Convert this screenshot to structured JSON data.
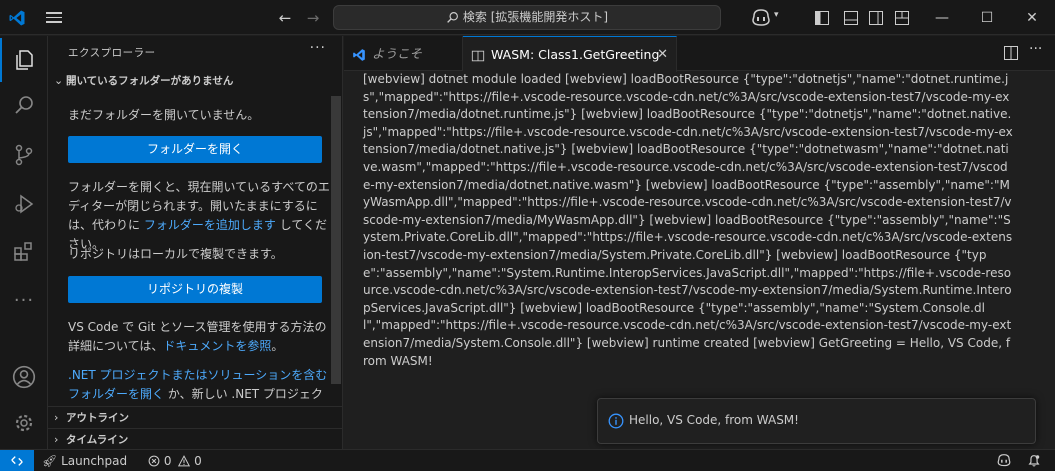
{
  "titlebar": {
    "search_text": "検索 [拡張機能開発ホスト]"
  },
  "sidebar": {
    "title": "エクスプローラー",
    "more": "···",
    "no_folder_section": "開いているフォルダーがありません",
    "no_folder_text": "まだフォルダーを開いていません。",
    "open_folder_button": "フォルダーを開く",
    "info_text_1": "フォルダーを開くと、現在開いているすべてのエディターが閉じられます。開いたままにするには、代わりに",
    "add_folder_link": "フォルダーを追加します",
    "info_text_2": "してください。",
    "clone_text": "リポジトリはローカルで複製できます。",
    "clone_button": "リポジトリの複製",
    "git_text": "VS Code で Git とソース管理を使用する方法の詳細については、",
    "docs_link": "ドキュメントを参照",
    "git_text_end": "。",
    "dotnet_link": ".NET プロジェクトまたはソリューションを含むフォルダーを開く",
    "dotnet_text": "か、新しい .NET プロジェクトを作成できま",
    "outline_section": "アウトライン",
    "timeline_section": "タイムライン"
  },
  "tabs": [
    {
      "label": "ようこそ"
    },
    {
      "label": "WASM: Class1.GetGreeting",
      "close": "✕"
    }
  ],
  "editor": {
    "log_text": "[webview] dotnet module loaded [webview] loadBootResource {\"type\":\"dotnetjs\",\"name\":\"dotnet.runtime.js\",\"mapped\":\"https://file+.vscode-resource.vscode-cdn.net/c%3A/src/vscode-extension-test7/vscode-my-extension7/media/dotnet.runtime.js\"} [webview] loadBootResource {\"type\":\"dotnetjs\",\"name\":\"dotnet.native.js\",\"mapped\":\"https://file+.vscode-resource.vscode-cdn.net/c%3A/src/vscode-extension-test7/vscode-my-extension7/media/dotnet.native.js\"} [webview] loadBootResource {\"type\":\"dotnetwasm\",\"name\":\"dotnet.native.wasm\",\"mapped\":\"https://file+.vscode-resource.vscode-cdn.net/c%3A/src/vscode-extension-test7/vscode-my-extension7/media/dotnet.native.wasm\"} [webview] loadBootResource {\"type\":\"assembly\",\"name\":\"MyWasmApp.dll\",\"mapped\":\"https://file+.vscode-resource.vscode-cdn.net/c%3A/src/vscode-extension-test7/vscode-my-extension7/media/MyWasmApp.dll\"} [webview] loadBootResource {\"type\":\"assembly\",\"name\":\"System.Private.CoreLib.dll\",\"mapped\":\"https://file+.vscode-resource.vscode-cdn.net/c%3A/src/vscode-extension-test7/vscode-my-extension7/media/System.Private.CoreLib.dll\"} [webview] loadBootResource {\"type\":\"assembly\",\"name\":\"System.Runtime.InteropServices.JavaScript.dll\",\"mapped\":\"https://file+.vscode-resource.vscode-cdn.net/c%3A/src/vscode-extension-test7/vscode-my-extension7/media/System.Runtime.InteropServices.JavaScript.dll\"} [webview] loadBootResource {\"type\":\"assembly\",\"name\":\"System.Console.dll\",\"mapped\":\"https://file+.vscode-resource.vscode-cdn.net/c%3A/src/vscode-extension-test7/vscode-my-extension7/media/System.Console.dll\"} [webview] runtime created [webview] GetGreeting = Hello, VS Code, from WASM!"
  },
  "notification": {
    "text": "Hello, VS Code, from WASM!"
  },
  "statusbar": {
    "launchpad": "Launchpad",
    "errors": "0",
    "warnings": "0"
  },
  "colors": {
    "accent": "#0078d4",
    "link": "#4daafc",
    "background": "#1f1f1f",
    "chrome": "#181818"
  }
}
